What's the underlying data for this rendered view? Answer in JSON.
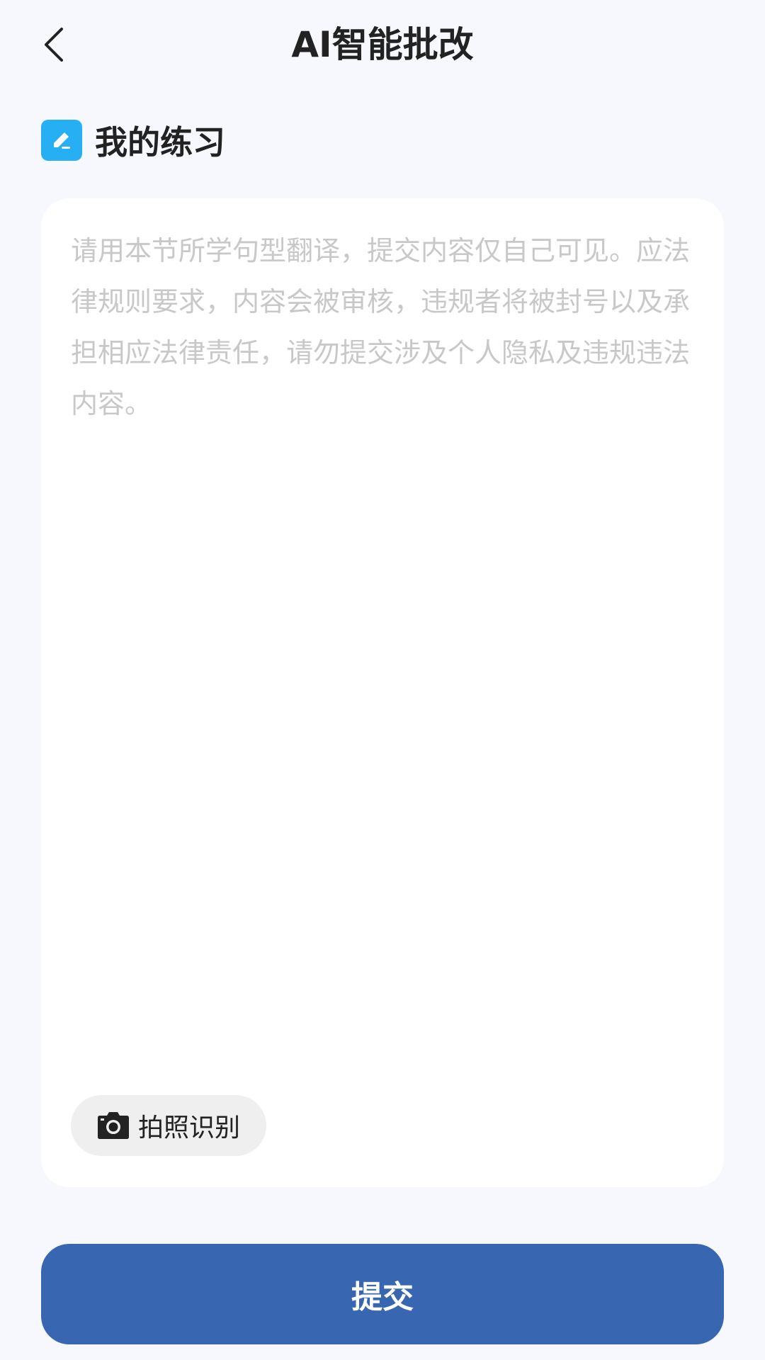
{
  "header": {
    "title": "AI智能批改",
    "back_icon": "chevron-left-icon"
  },
  "section": {
    "title": "我的练习",
    "icon": "pencil-edit-icon",
    "icon_color": "#26b0f3"
  },
  "editor": {
    "value": "",
    "placeholder": "请用本节所学句型翻译，提交内容仅自己可见。应法律规则要求，内容会被审核，违规者将被封号以及承担相应法律责任，请勿提交涉及个人隐私及违规违法内容。"
  },
  "photo_button": {
    "label": "拍照识别",
    "icon": "camera-icon"
  },
  "submit_button": {
    "label": "提交",
    "color": "#3866b0"
  }
}
